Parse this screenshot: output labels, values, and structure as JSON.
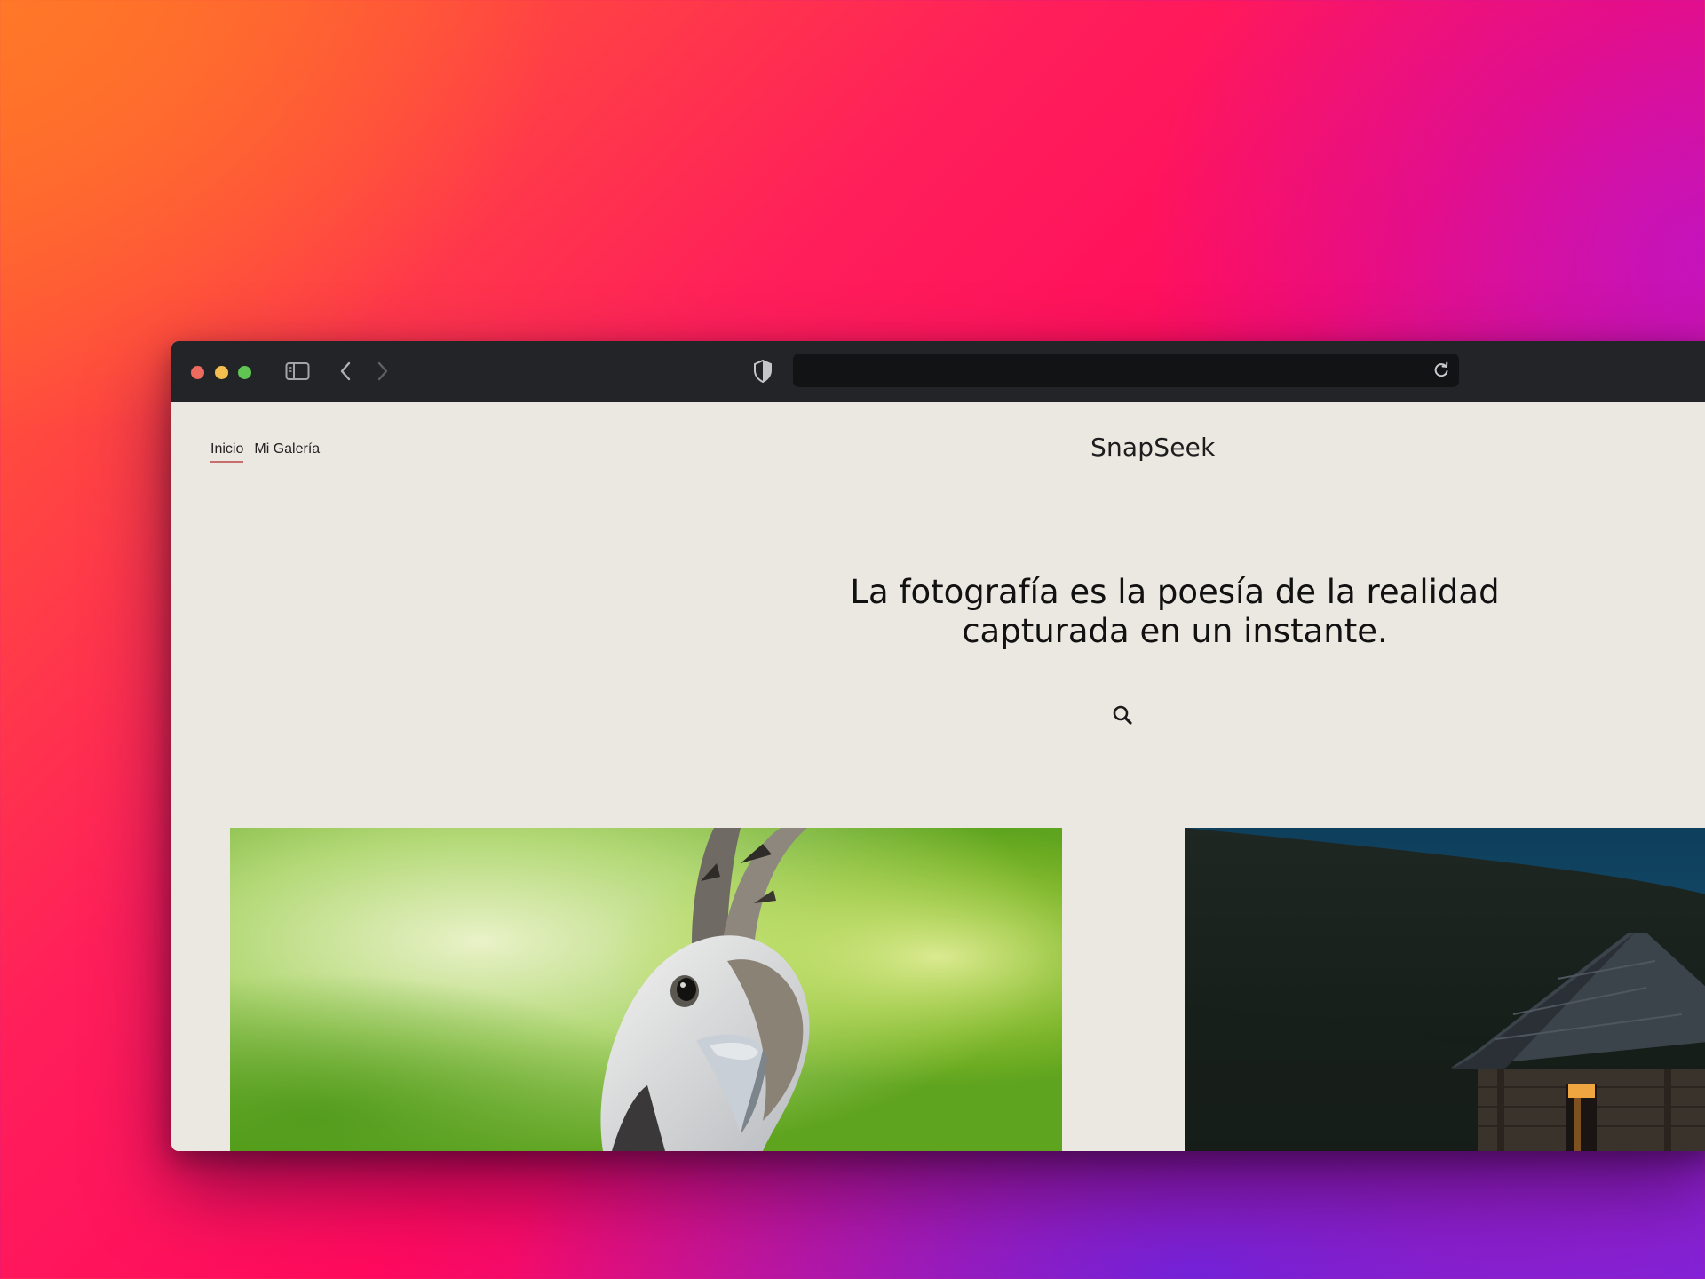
{
  "browser": {
    "traffic_lights": {
      "close": "#ed6a5e",
      "minimize": "#f5bf4f",
      "zoom": "#61c554"
    },
    "toolbar_icons": [
      "sidebar-icon",
      "back-arrow-icon",
      "forward-arrow-icon",
      "shield-icon",
      "reload-icon"
    ],
    "address_value": ""
  },
  "site": {
    "brand": "SnapSeek",
    "nav": [
      {
        "label": "Inicio",
        "active": true
      },
      {
        "label": "Mi Galería",
        "active": false
      }
    ],
    "hero": {
      "line1": "La fotografía es la poesía de la realidad",
      "line2": "capturada en un instante."
    },
    "search_icon": "search-icon",
    "accent": "#c96e6e",
    "background": "#ebe7e1"
  },
  "gallery": [
    {
      "subject": "bird-closeup-photo"
    },
    {
      "subject": "mountain-cabin-photo"
    }
  ]
}
